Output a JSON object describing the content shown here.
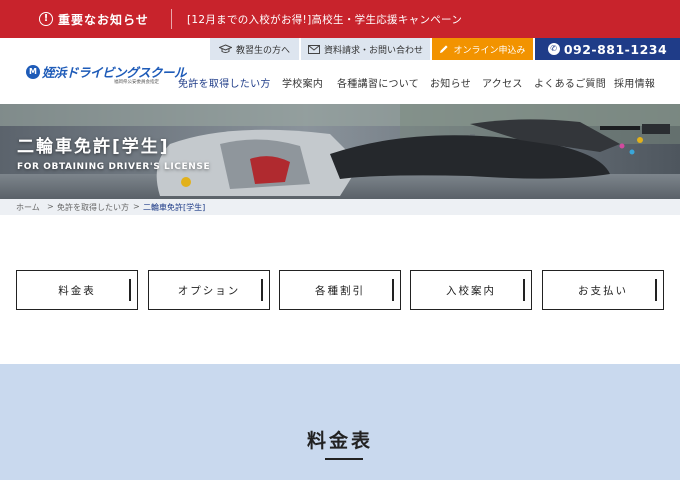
{
  "alert": {
    "title": "重要なお知らせ",
    "message": "[12月までの入校がお得!]高校生・学生応援キャンペーン"
  },
  "utility": {
    "student": "教習生の方へ",
    "docs": "資料請求・お問い合わせ",
    "apply": "オンライン申込み",
    "phone": "092-881-1234"
  },
  "logo": {
    "mark": "M",
    "name": "姪浜ドライビングスクール",
    "sub": "福岡県公安委員会指定"
  },
  "nav": {
    "items": [
      {
        "label": "免許を取得したい方"
      },
      {
        "label": "学校案内"
      },
      {
        "label": "各種講習について"
      },
      {
        "label": "お知らせ"
      },
      {
        "label": "アクセス"
      },
      {
        "label": "よくあるご質問"
      },
      {
        "label": "採用情報"
      }
    ]
  },
  "hero": {
    "title": "二輪車免許[学生]",
    "subtitle": "FOR OBTAINING DRIVER'S LICENSE"
  },
  "breadcrumb": {
    "home": "ホーム",
    "parent": "免許を取得したい方",
    "current": "二輪車免許[学生]",
    "separator": ">"
  },
  "tabs": [
    {
      "label": "料金表"
    },
    {
      "label": "オプション"
    },
    {
      "label": "各種割引"
    },
    {
      "label": "入校案内"
    },
    {
      "label": "お支払い"
    }
  ],
  "section": {
    "title": "料金表"
  },
  "colors": {
    "alert": "#c8232c",
    "primary": "#1f3c88",
    "accent": "#f29300",
    "section_bg": "#c9d9ee"
  }
}
